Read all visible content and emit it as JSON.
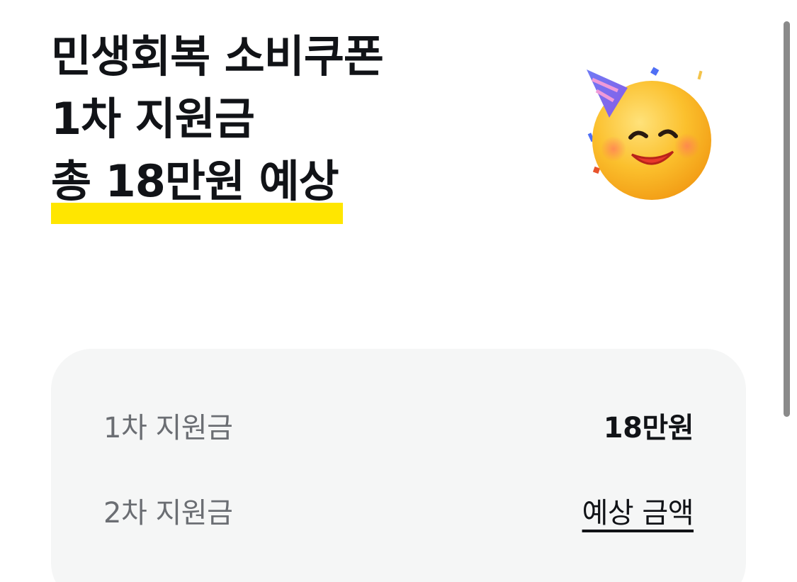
{
  "headline": {
    "line1": "민생회복 소비쿠폰",
    "line2": "1차 지원금",
    "line3": "총 18만원 예상",
    "highlight_color": "#ffe600"
  },
  "illustration": {
    "icon": "party-face-emoji-icon"
  },
  "summary_card": {
    "rows": [
      {
        "label": "1차 지원금",
        "value": "18만원"
      },
      {
        "label": "2차 지원금",
        "value": "예상 금액"
      }
    ]
  }
}
